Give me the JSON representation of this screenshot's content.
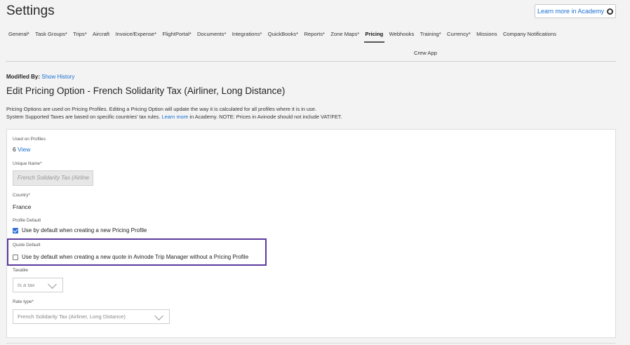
{
  "header": {
    "title": "Settings",
    "academy_button": "Learn more in Academy"
  },
  "tabs": [
    {
      "label": "General*"
    },
    {
      "label": "Task Groups*"
    },
    {
      "label": "Trips*"
    },
    {
      "label": "Aircraft"
    },
    {
      "label": "Invoice/Expense*"
    },
    {
      "label": "FlightPortal*"
    },
    {
      "label": "Documents*"
    },
    {
      "label": "Integrations*"
    },
    {
      "label": "QuickBooks*"
    },
    {
      "label": "Reports*"
    },
    {
      "label": "Zone Maps*"
    },
    {
      "label": "Pricing"
    },
    {
      "label": "Webhooks"
    },
    {
      "label": "Training*"
    },
    {
      "label": "Currency*"
    },
    {
      "label": "Missions"
    },
    {
      "label": "Company Notifications"
    }
  ],
  "subtab": "Crew App",
  "modified": {
    "label": "Modified By:",
    "link": "Show History"
  },
  "edit_title": "Edit Pricing Option - French Solidarity Tax (Airliner, Long Distance)",
  "description": {
    "line1": "Pricing Options are used on Pricing Profiles. Editing a Pricing Option will update the way it is calculated for all profiles where it is in use.",
    "line2_pre": "System Supported Taxes are based on specific countries' tax rules.",
    "line2_link": "Learn more",
    "line2_post": "in Academy. NOTE: Prices in Avinode should not include VAT/FET."
  },
  "form": {
    "used_on_profiles_label": "Used on Profiles",
    "used_on_profiles_count": "6",
    "used_on_profiles_link": "View",
    "unique_name_label": "Unique Name*",
    "unique_name_value": "French Solidarity Tax (Airline",
    "country_label": "Country*",
    "country_value": "France",
    "profile_default_label": "Profile Default",
    "profile_default_text": "Use by default when creating a new Pricing Profile",
    "profile_default_checked": true,
    "quote_default_label": "Quote Default",
    "quote_default_text": "Use by default when creating a new quote in Avinode Trip Manager without a Pricing Profile",
    "quote_default_checked": false,
    "taxable_label": "Taxable",
    "taxable_value": "Is a tax",
    "rate_type_label": "Rate type*",
    "rate_type_value": "French Solidarity Tax (Airliner, Long Distance)"
  },
  "colors": {
    "link": "#1a6fd1",
    "highlight_border": "#5b3a9e",
    "checkbox_on": "#2f6fd6"
  }
}
